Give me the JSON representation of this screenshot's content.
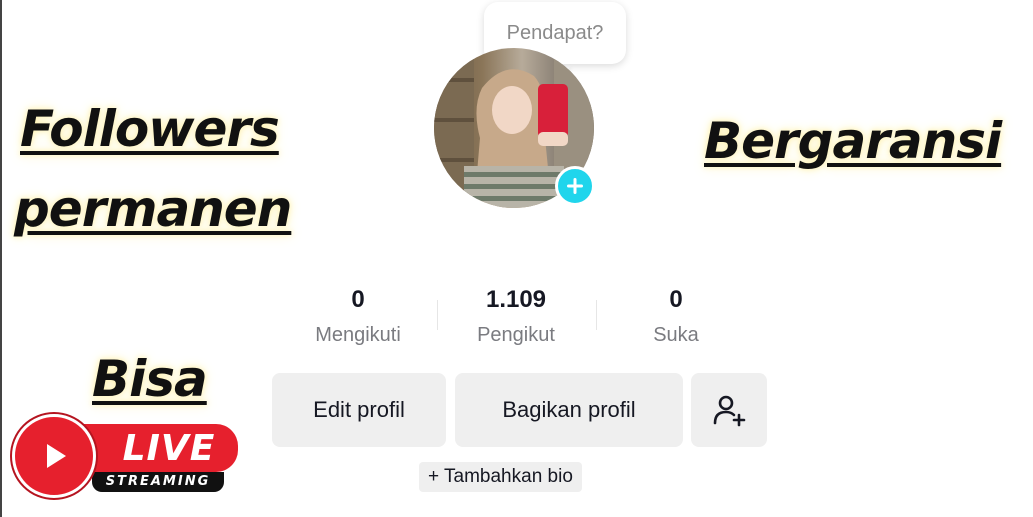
{
  "speech_bubble": {
    "text": "Pendapat?"
  },
  "promo": {
    "line1": "Followers",
    "line2": "permanen",
    "right": "Bergaransi",
    "bottom": "Bisa"
  },
  "live_badge": {
    "main": "LIVE",
    "sub": "STREAMING"
  },
  "stats": [
    {
      "value": "0",
      "label": "Mengikuti"
    },
    {
      "value": "1.109",
      "label": "Pengikut"
    },
    {
      "value": "0",
      "label": "Suka"
    }
  ],
  "buttons": {
    "edit_profile": "Edit profil",
    "share_profile": "Bagikan profil",
    "add_friend_icon": "add-user-icon"
  },
  "bio": {
    "add_label": "+ Tambahkan bio"
  },
  "colors": {
    "accent": "#20d5ec",
    "live_red": "#e6202d",
    "button_bg": "#efefef",
    "text_dark": "#161823",
    "text_muted": "#7a7b80"
  }
}
